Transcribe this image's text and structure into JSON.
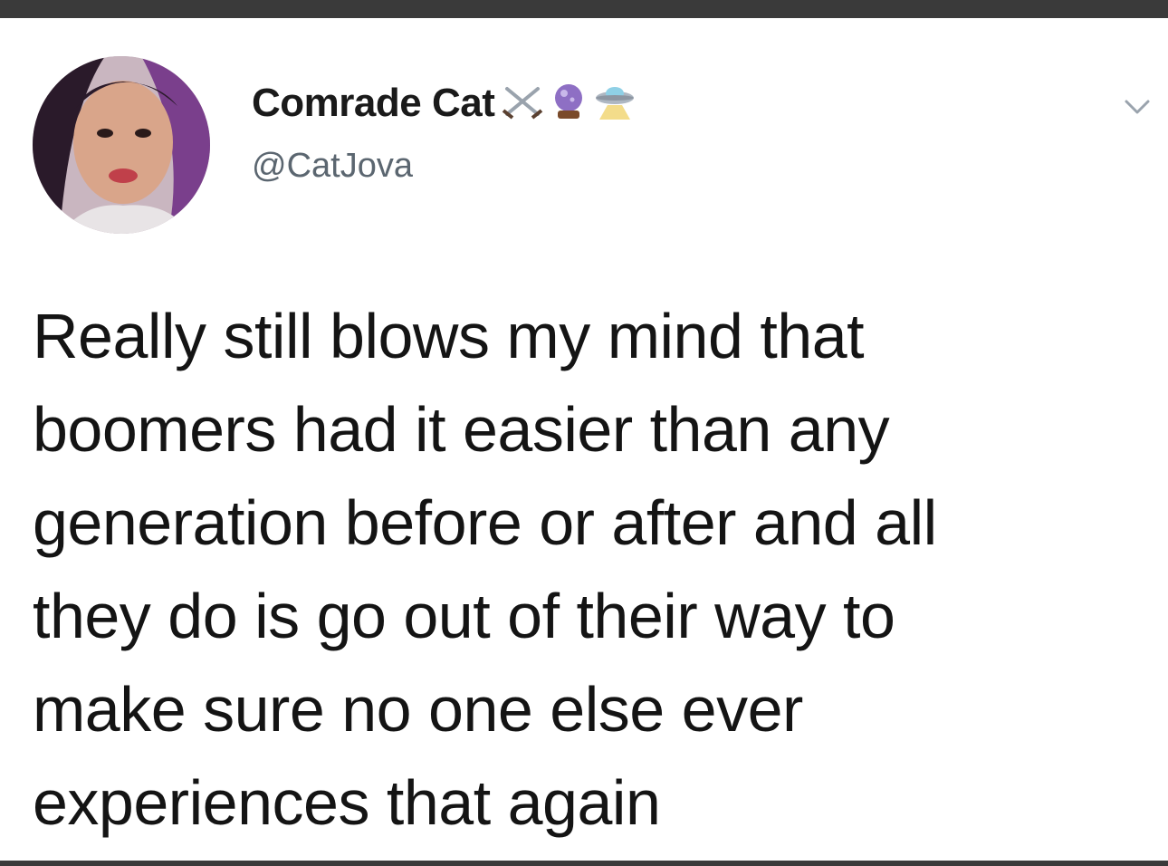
{
  "tweet": {
    "display_name": "Comrade Cat",
    "display_name_emojis": [
      "crossed-swords-icon",
      "crystal-ball-icon",
      "flying-saucer-icon"
    ],
    "handle": "@CatJova",
    "body_lines": [
      "Really still blows my mind that",
      "boomers had it easier than any",
      "generation before or after and all",
      "they do is go out of their way to",
      "make sure no one else ever",
      "experiences that again"
    ]
  },
  "colors": {
    "frame_bar": "#3a3a3a",
    "text_primary": "#141414",
    "text_secondary": "#5b6670",
    "background": "#ffffff"
  }
}
